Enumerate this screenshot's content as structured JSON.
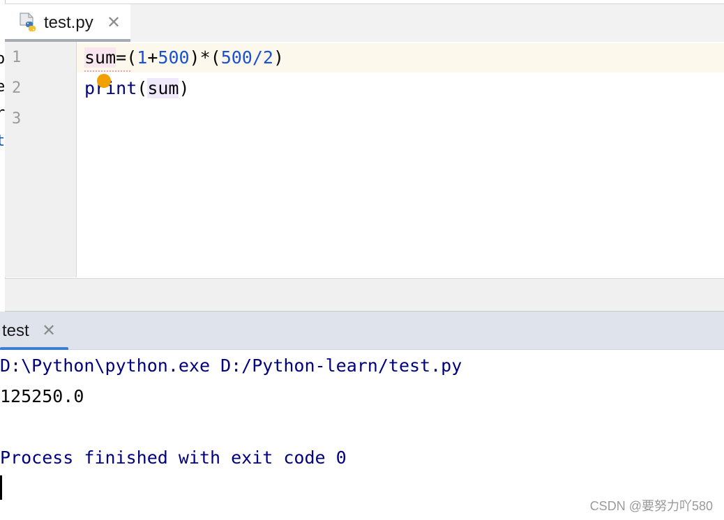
{
  "left_panel": {
    "fragments": [
      "o",
      "e",
      "r",
      "t"
    ]
  },
  "editor": {
    "tab": {
      "filename": "test.py",
      "close_glyph": "✕",
      "icon": "python-file-icon"
    },
    "line_numbers": [
      "1",
      "2",
      "3"
    ],
    "lines": {
      "line1": {
        "t1": "sum",
        "t2": "=(",
        "t3": "1",
        "t4": "+",
        "t5": "500",
        "t6": ")*(",
        "t7": "500",
        "t8": "/",
        "t9": "2",
        "t10": ")"
      },
      "line2": {
        "t1": "print",
        "t2": "(",
        "t3": "sum",
        "t4": ")"
      }
    },
    "colors": {
      "number": "#1a50d8",
      "builtin": "#000080",
      "caret_line": "#fcf9ec",
      "intention_bulb": "#f0a000"
    }
  },
  "run": {
    "tab": {
      "label": "test",
      "close_glyph": "✕"
    },
    "console": {
      "command": "D:\\Python\\python.exe D:/Python-learn/test.py",
      "output": "125250.0",
      "exit_message": "Process finished with exit code 0"
    },
    "colors": {
      "accent": "#3d7dd6",
      "command_text": "#000080"
    }
  },
  "watermark": "CSDN @要努力吖580"
}
